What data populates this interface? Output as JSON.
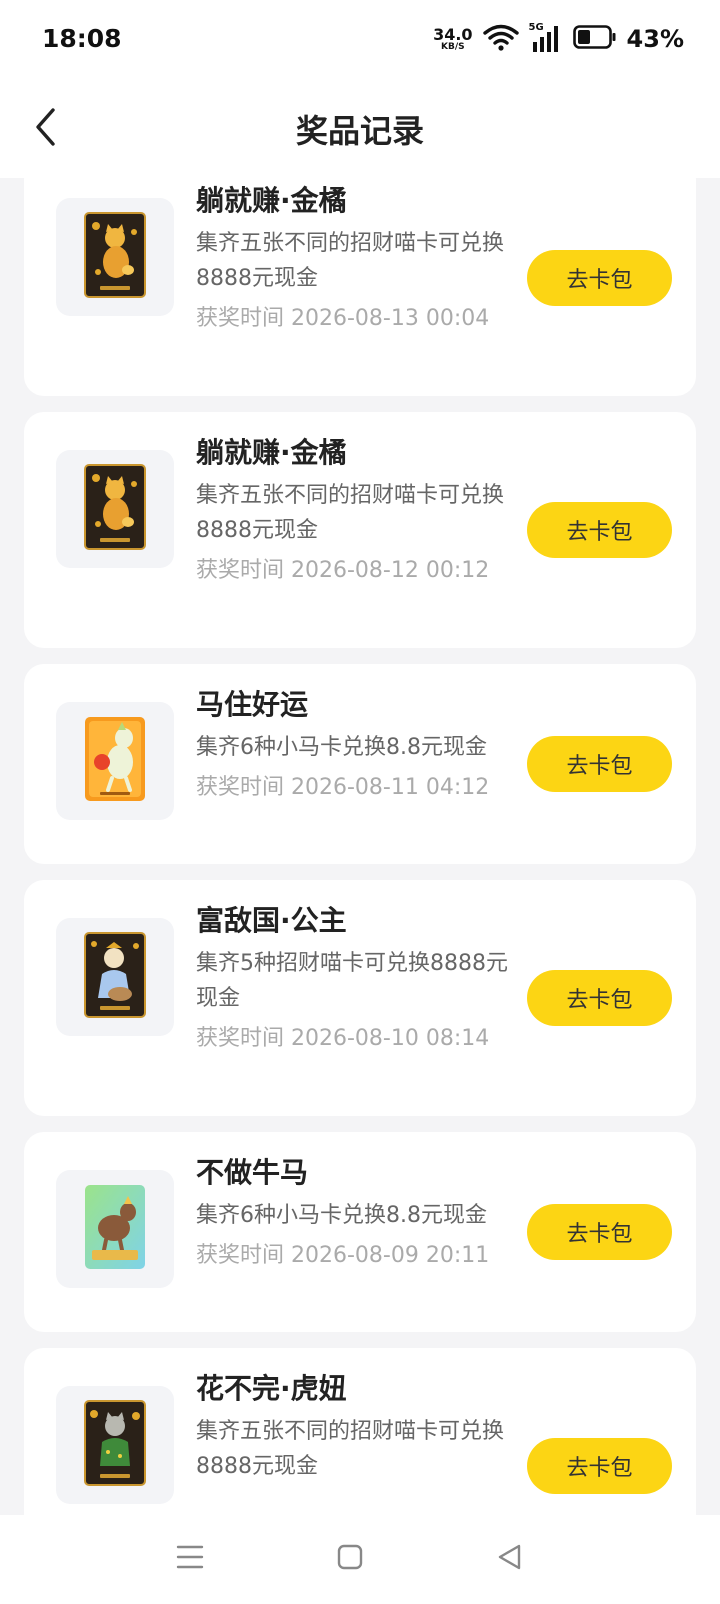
{
  "status_bar": {
    "time": "18:08",
    "net_speed_value": "34.0",
    "net_speed_unit": "KB/S",
    "signal_label": "5G",
    "battery_percent": "43%",
    "battery_level": 0.43
  },
  "header": {
    "title": "奖品记录"
  },
  "records": [
    {
      "title": "躺就赚·金橘",
      "desc": "集齐五张不同的招财喵卡可兑换8888元现金",
      "time": "获奖时间 2026-08-13 00:04",
      "button": "去卡包",
      "card_label": "躺就赚·金橘",
      "icon": "golden-cat-card-icon"
    },
    {
      "title": "躺就赚·金橘",
      "desc": "集齐五张不同的招财喵卡可兑换8888元现金",
      "time": "获奖时间 2026-08-12 00:12",
      "button": "去卡包",
      "card_label": "躺就赚·金橘",
      "icon": "golden-cat-card-icon"
    },
    {
      "title": "马住好运",
      "desc": "集齐6种小马卡兑换8.8元现金",
      "time": "获奖时间 2026-08-11 04:12",
      "button": "去卡包",
      "card_label": "马住好运",
      "icon": "lucky-horse-card-icon"
    },
    {
      "title": "富敌国·公主",
      "desc": "集齐5种招财喵卡可兑换8888元现金",
      "time": "获奖时间 2026-08-10 08:14",
      "button": "去卡包",
      "card_label": "富敌国·公主",
      "icon": "princess-cat-card-icon"
    },
    {
      "title": "不做牛马",
      "desc": "集齐6种小马卡兑换8.8元现金",
      "time": "获奖时间 2026-08-09 20:11",
      "button": "去卡包",
      "card_label": "不做牛马",
      "icon": "horse-card-icon"
    },
    {
      "title": "花不完·虎妞",
      "desc": "集齐五张不同的招财喵卡可兑换8888元现金",
      "time": "",
      "button": "去卡包",
      "card_label": "花不完·虎妞",
      "icon": "tiger-cat-card-icon"
    }
  ],
  "colors": {
    "accent": "#fcd514",
    "background": "#f4f4f6",
    "card_dark": "#2a2118",
    "card_gold": "#c9962f"
  }
}
